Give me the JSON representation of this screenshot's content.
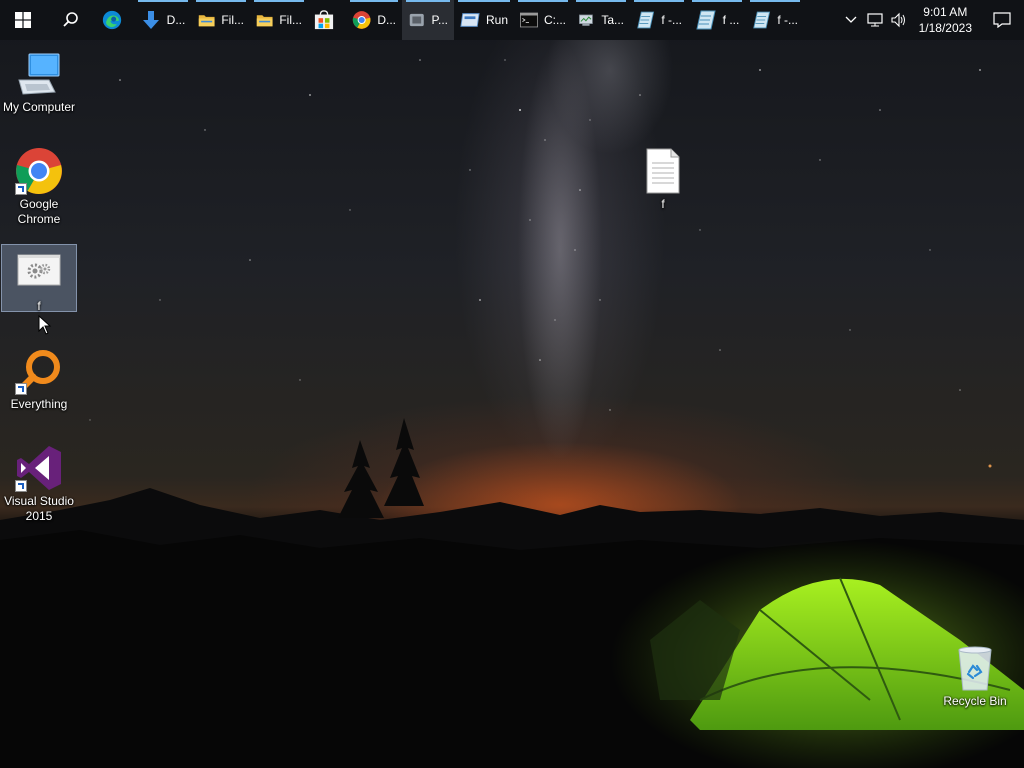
{
  "taskbar": {
    "start_icon": "windows-start-icon",
    "search_icon": "search-icon",
    "apps": [
      {
        "icon": "edge-icon",
        "label": ""
      },
      {
        "icon": "download-arrow-icon",
        "label": "D..."
      },
      {
        "icon": "folder-icon",
        "label": "Fil..."
      },
      {
        "icon": "folder-icon",
        "label": "Fil..."
      },
      {
        "icon": "store-icon",
        "label": ""
      },
      {
        "icon": "chrome-icon",
        "label": "D..."
      },
      {
        "icon": "app-icon",
        "label": "P..."
      },
      {
        "icon": "run-icon",
        "label": "Run"
      },
      {
        "icon": "cmd-icon",
        "label": "C:..."
      },
      {
        "icon": "task-manager-icon",
        "label": "Ta..."
      },
      {
        "icon": "notepad-icon",
        "label": "f -..."
      },
      {
        "icon": "notepad-icon",
        "label": "f ..."
      },
      {
        "icon": "notepad-icon",
        "label": "f -..."
      }
    ],
    "tray": {
      "time": "9:01 AM",
      "date": "1/18/2023",
      "icons": [
        "chevron-up-icon",
        "network-icon",
        "volume-icon"
      ],
      "notification_icon": "notification-icon"
    }
  },
  "desktop": {
    "icons": [
      {
        "label": "My Computer",
        "icon": "computer-icon"
      },
      {
        "label": "Google Chrome",
        "icon": "chrome-icon"
      },
      {
        "label": "f",
        "icon": "settings-file-icon"
      },
      {
        "label": "Everything",
        "icon": "everything-search-icon"
      },
      {
        "label": "Visual Studio 2015",
        "icon": "visual-studio-icon"
      },
      {
        "label": "f",
        "icon": "text-file-icon"
      },
      {
        "label": "Recycle Bin",
        "icon": "recycle-bin-icon"
      }
    ]
  },
  "colors": {
    "taskbar_bg": "#101216",
    "running_indicator": "#76b9ed",
    "selection": "#8ca0be"
  }
}
